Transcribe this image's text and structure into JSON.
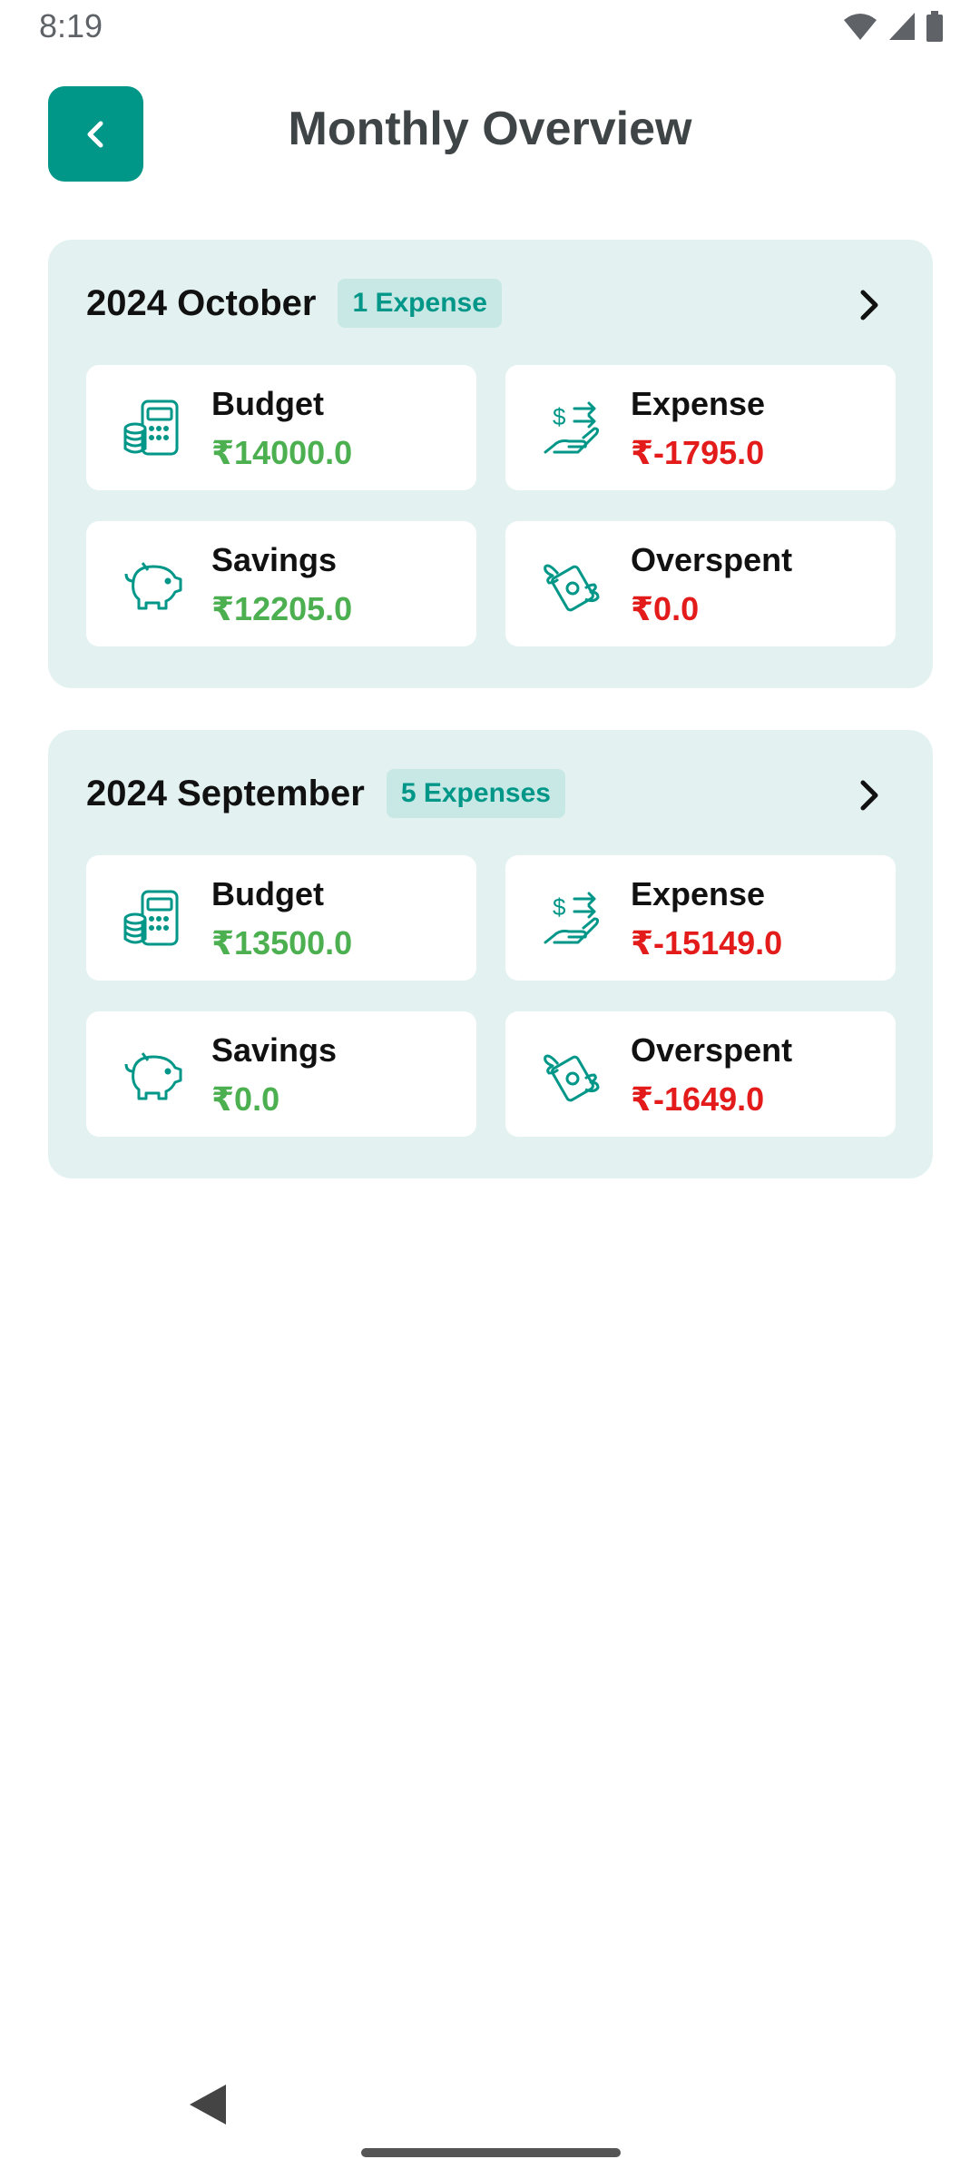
{
  "status_bar": {
    "time": "8:19"
  },
  "header": {
    "title": "Monthly Overview",
    "back_icon": "chevron-left-icon"
  },
  "colors": {
    "accent": "#009688",
    "card_bg": "#e3f2f1",
    "positive": "#4caf50",
    "negative": "#e31b1b"
  },
  "months": [
    {
      "title": "2024 October",
      "badge": "1 Expense",
      "stats": {
        "budget": {
          "label": "Budget",
          "value": "₹14000.0",
          "icon": "budget-calculator-icon"
        },
        "expense": {
          "label": "Expense",
          "value": "₹-1795.0",
          "icon": "money-hand-icon"
        },
        "savings": {
          "label": "Savings",
          "value": "₹12205.0",
          "icon": "piggy-bank-icon"
        },
        "overspent": {
          "label": "Overspent",
          "value": "₹0.0",
          "icon": "flying-money-icon"
        }
      }
    },
    {
      "title": "2024 September",
      "badge": "5 Expenses",
      "stats": {
        "budget": {
          "label": "Budget",
          "value": "₹13500.0",
          "icon": "budget-calculator-icon"
        },
        "expense": {
          "label": "Expense",
          "value": "₹-15149.0",
          "icon": "money-hand-icon"
        },
        "savings": {
          "label": "Savings",
          "value": "₹0.0",
          "icon": "piggy-bank-icon"
        },
        "overspent": {
          "label": "Overspent",
          "value": "₹-1649.0",
          "icon": "flying-money-icon"
        }
      }
    }
  ]
}
